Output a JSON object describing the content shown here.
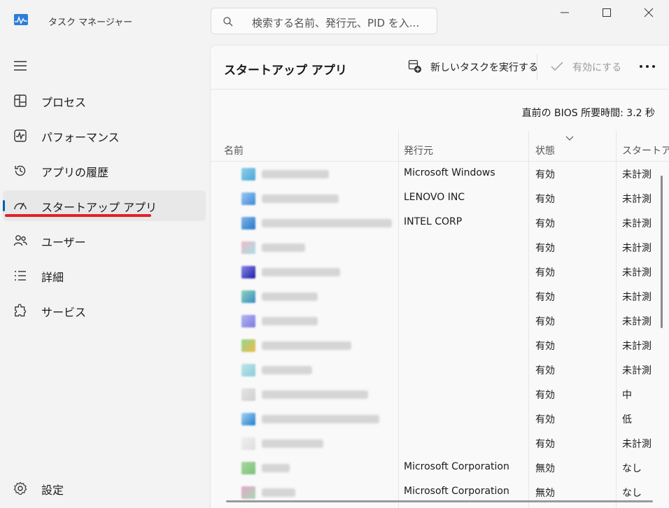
{
  "window": {
    "title": "タスク マネージャー",
    "search_placeholder": "検索する名前、発行元、PID を入...",
    "icons": {
      "app": "task-manager-icon",
      "search": "search-icon",
      "minimize": "minimize-icon",
      "maximize": "maximize-icon",
      "close": "close-icon"
    }
  },
  "sidebar": {
    "menu_icon": "hamburger-icon",
    "items": [
      {
        "label": "プロセス",
        "icon": "processes-icon"
      },
      {
        "label": "パフォーマンス",
        "icon": "performance-icon"
      },
      {
        "label": "アプリの履歴",
        "icon": "history-icon"
      },
      {
        "label": "スタートアップ アプリ",
        "icon": "startup-gauge-icon",
        "active": true
      },
      {
        "label": "ユーザー",
        "icon": "users-icon"
      },
      {
        "label": "詳細",
        "icon": "details-list-icon"
      },
      {
        "label": "サービス",
        "icon": "services-puzzle-icon"
      }
    ],
    "settings": {
      "label": "設定",
      "icon": "gear-icon"
    },
    "accent_color": "#005fb8",
    "highlight_color": "#e0202a"
  },
  "main": {
    "title": "スタートアップ アプリ",
    "toolbar": {
      "new_task": "新しいタスクを実行する",
      "enable": "有効にする",
      "more": "more-options-icon"
    },
    "bios_time": "直前の BIOS 所要時間:  3.2 秒",
    "columns": [
      "名前",
      "発行元",
      "状態",
      "スタートアップ"
    ],
    "rows": [
      {
        "publisher": "Microsoft Windows",
        "status": "有効",
        "impact": "未計測"
      },
      {
        "publisher": "LENOVO INC",
        "status": "有効",
        "impact": "未計測"
      },
      {
        "publisher": "INTEL CORP",
        "status": "有効",
        "impact": "未計測"
      },
      {
        "publisher": "",
        "status": "有効",
        "impact": "未計測"
      },
      {
        "publisher": "",
        "status": "有効",
        "impact": "未計測"
      },
      {
        "publisher": "",
        "status": "有効",
        "impact": "未計測"
      },
      {
        "publisher": "",
        "status": "有効",
        "impact": "未計測"
      },
      {
        "publisher": "",
        "status": "有効",
        "impact": "未計測"
      },
      {
        "publisher": "",
        "status": "有効",
        "impact": "未計測"
      },
      {
        "publisher": "",
        "status": "有効",
        "impact": "中"
      },
      {
        "publisher": "",
        "status": "有効",
        "impact": "低"
      },
      {
        "publisher": "",
        "status": "有効",
        "impact": "未計測"
      },
      {
        "publisher": "Microsoft Corporation",
        "status": "無効",
        "impact": "なし"
      },
      {
        "publisher": "Microsoft Corporation",
        "status": "無効",
        "impact": "なし"
      }
    ]
  }
}
